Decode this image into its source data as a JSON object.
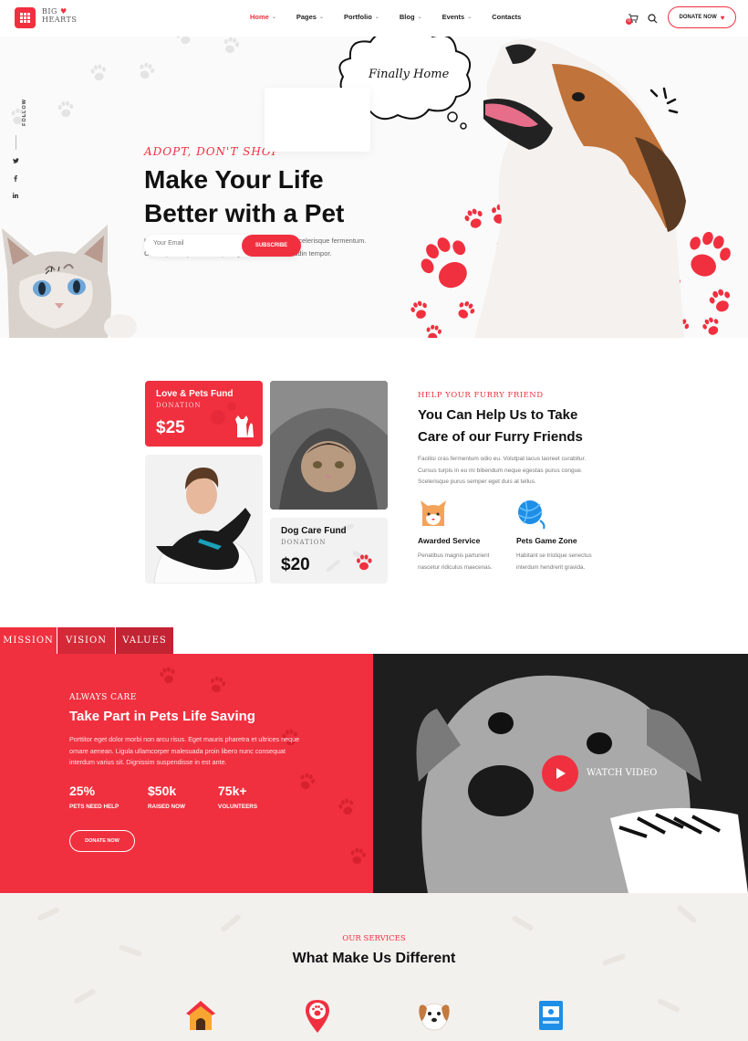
{
  "brand": {
    "name_line1": "BIG",
    "name_line2": "HEARTS",
    "accent": "#f0303f"
  },
  "nav": {
    "items": [
      {
        "label": "Home",
        "has_dropdown": true,
        "active": true
      },
      {
        "label": "Pages",
        "has_dropdown": true
      },
      {
        "label": "Portfolio",
        "has_dropdown": true
      },
      {
        "label": "Blog",
        "has_dropdown": true
      },
      {
        "label": "Events",
        "has_dropdown": true
      },
      {
        "label": "Contacts",
        "has_dropdown": false
      }
    ],
    "cart_count": "0",
    "donate_label": "DONATE NOW"
  },
  "hero": {
    "follow_label": "FOLLOW",
    "social": [
      "twitter-icon",
      "facebook-icon",
      "linkedin-icon"
    ],
    "thought_bubble": "Finally Home",
    "kicker": "ADOPT, DON'T SHOP",
    "title_line1": "Make Your Life",
    "title_line2": "Better with a Pet",
    "text_line1": "Ultrices neque euismod elementum. Quis lobortis scelerisque fermentum.",
    "text_line2": "Consequat ut porttitor neque egestas diam sollicitudin tempor.",
    "email_placeholder": "Your Email",
    "subscribe_label": "SUBSCRIBE"
  },
  "funds": [
    {
      "title": "Love & Pets Fund",
      "sub": "DONATION",
      "amount": "$25"
    },
    {
      "title": "Dog Care Fund",
      "sub": "DONATION",
      "amount": "$20"
    }
  ],
  "about": {
    "kicker": "HELP YOUR FURRY FRIEND",
    "title_line1": "You Can Help Us to Take",
    "title_line2": "Care of our Furry Friends",
    "text_line1": "Facilisi cras fermentum odio eu. Volutpat lacus laoreet curabitur.",
    "text_line2": "Cursus turpis in eu mi bibendum neque egestas purus congue.",
    "text_line3": "Scelerisque purus semper eget duis at tellus.",
    "features": [
      {
        "icon": "cat-face-icon",
        "title": "Awarded Service",
        "line1": "Penatibus magnis parturient",
        "line2": "nascetur ridiculus maecenas."
      },
      {
        "icon": "yarn-ball-icon",
        "title": "Pets Game Zone",
        "line1": "Habitant se tristique senectus",
        "line2": "interdum hendrerit gravida."
      }
    ]
  },
  "tabs": [
    {
      "label": "MISSION",
      "active": true
    },
    {
      "label": "VISION"
    },
    {
      "label": "VALUES"
    }
  ],
  "mission": {
    "kicker": "ALWAYS CARE",
    "title": "Take Part in Pets Life Saving",
    "text_line1": "Porttitor eget dolor morbi non arcu risus. Eget mauris pharetra et ultrices neque",
    "text_line2": "ornare aenean. Ligula ullamcorper malesuada proin libero nunc consequat",
    "text_line3": "interdum varius sit. Dignissim suspendisse in est ante.",
    "stats": [
      {
        "value": "25%",
        "label": "PETS NEED HELP"
      },
      {
        "value": "$50k",
        "label": "RAISED NOW"
      },
      {
        "value": "75k+",
        "label": "VOLUNTEERS"
      }
    ],
    "donate_label": "DONATE NOW",
    "watch_label": "WATCH VIDEO"
  },
  "services": {
    "kicker": "OUR SERVICES",
    "title": "What Make Us Different",
    "icons": [
      "dog-house-icon",
      "location-pin-paw-icon",
      "dog-face-icon",
      "pet-id-card-icon"
    ]
  }
}
